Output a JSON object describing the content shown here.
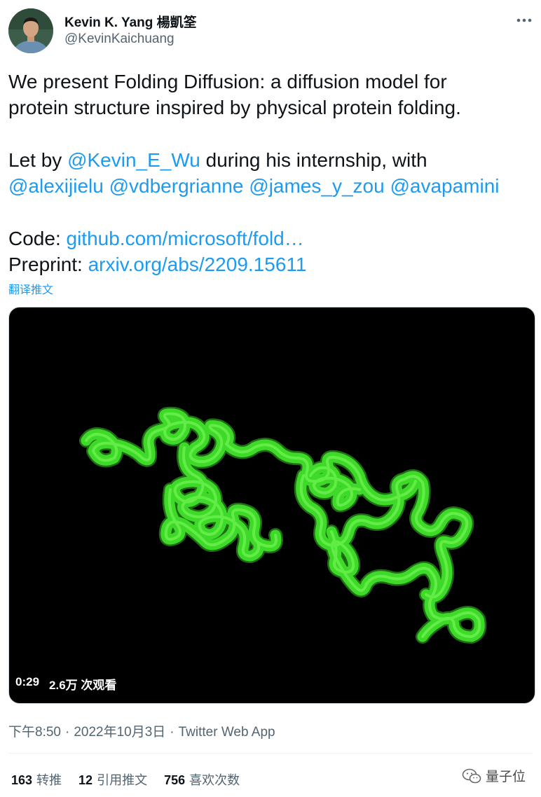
{
  "author": {
    "display_name": "Kevin K. Yang 楊凱筌",
    "handle": "@KevinKaichuang"
  },
  "more_icon": "more-horizontal-icon",
  "tweet": {
    "line1": "We present Folding Diffusion: a diffusion model for",
    "line2": "protein structure inspired by physical protein folding.",
    "line3_pre": "Let by ",
    "mention_kevin_wu": "@Kevin_E_Wu",
    "line3_post": " during his internship, with",
    "mention_alexijielu": "@alexijielu",
    "mention_vdbergrianne": "@vdbergrianne",
    "mention_james": "@james_y_zou",
    "mention_ava": "@avapamini",
    "code_label": "Code: ",
    "code_link": "github.com/microsoft/fold…",
    "preprint_label": "Preprint: ",
    "preprint_link": "arxiv.org/abs/2209.15611",
    "translate": "翻译推文"
  },
  "media": {
    "duration": "0:29",
    "views": "2.6万 次观看",
    "strand_color": "#3fd92a"
  },
  "meta": {
    "time": "下午8:50",
    "date": "2022年10月3日",
    "source": "Twitter Web App",
    "separator": "·"
  },
  "stats": [
    {
      "count": "163",
      "label": "转推"
    },
    {
      "count": "12",
      "label": "引用推文"
    },
    {
      "count": "756",
      "label": "喜欢次数"
    }
  ],
  "watermark": {
    "text": "量子位",
    "icon": "wechat-icon"
  }
}
